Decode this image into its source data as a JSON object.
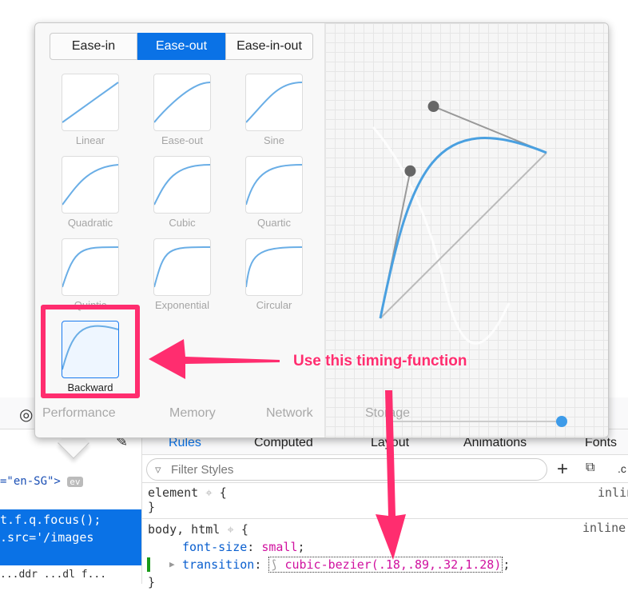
{
  "devtools": {
    "toolbar_tabs": [
      "Performance",
      "Memory",
      "Network",
      "Storage"
    ],
    "sidebar_tabs": [
      "Rules",
      "Computed",
      "Layout",
      "Animations",
      "Fonts"
    ],
    "filter_placeholder": "Filter Styles",
    "class_button": ".c",
    "markup": {
      "attr_line": "=\"en-SG\">",
      "ev_badge": "ev",
      "sel1": "t.f.q.focus();",
      "sel2": ".src='/images",
      "bottom": "...ddr ...dl f..."
    },
    "rules": [
      {
        "selector": "element",
        "source": "inlin",
        "body": []
      },
      {
        "selector": "body, html",
        "source": "inline",
        "body": [
          {
            "prop": "font-size",
            "value": "small"
          },
          {
            "prop": "transition",
            "value": "cubic-bezier(.18,.89,.32,1.28)"
          }
        ]
      }
    ]
  },
  "popup": {
    "segments": [
      {
        "label": "Ease-in",
        "active": false
      },
      {
        "label": "Ease-out",
        "active": true
      },
      {
        "label": "Ease-in-out",
        "active": false
      }
    ],
    "presets": [
      {
        "label": "Linear"
      },
      {
        "label": "Ease-out"
      },
      {
        "label": "Sine"
      },
      {
        "label": "Quadratic"
      },
      {
        "label": "Cubic"
      },
      {
        "label": "Quartic"
      },
      {
        "label": "Quintic"
      },
      {
        "label": "Exponential"
      },
      {
        "label": "Circular"
      },
      {
        "label": "Backward",
        "selected": true
      }
    ],
    "bezier": [
      0.18,
      0.89,
      0.32,
      1.28
    ]
  },
  "annotation": {
    "text": "Use this timing-function",
    "color": "#ff2d6f"
  },
  "colors": {
    "accent": "#0a72e6",
    "curve": "#4aa0e0",
    "annotation": "#ff2d6f"
  }
}
